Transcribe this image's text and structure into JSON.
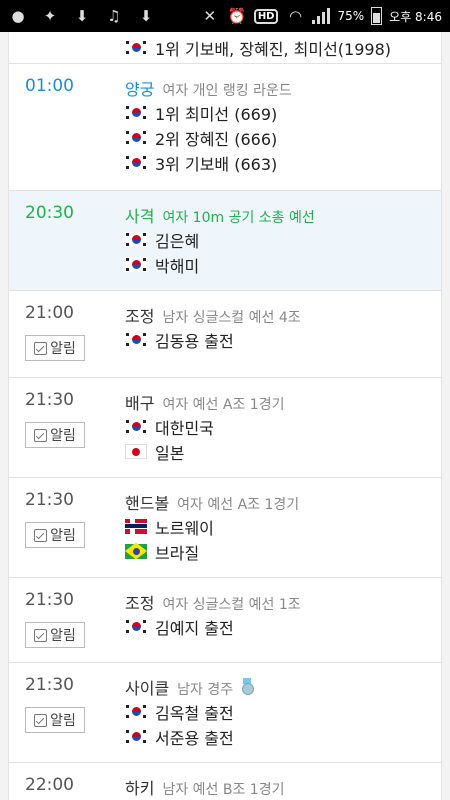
{
  "status_bar": {
    "battery": "75%",
    "time": "오후 8:46",
    "hd": "HD"
  },
  "top_row": {
    "text": "1위 기보배, 장혜진, 최미선(1998)"
  },
  "events": [
    {
      "time": "01:00",
      "sport": "양궁",
      "desc": "여자 개인 랭킹 라운드",
      "lines": [
        "1위 최미선 (669)",
        "2위 장혜진 (666)",
        "3위 기보배 (663)"
      ]
    },
    {
      "time": "20:30",
      "sport": "사격",
      "desc": "여자 10m 공기 소총 예선",
      "lines": [
        "김은혜",
        "박해미"
      ]
    },
    {
      "time": "21:00",
      "alarm": "알림",
      "sport": "조정",
      "desc": "남자 싱글스컬 예선 4조",
      "lines": [
        "김동용 출전"
      ]
    },
    {
      "time": "21:30",
      "alarm": "알림",
      "sport": "배구",
      "desc": "여자 예선 A조 1경기",
      "lines": [
        "대한민국",
        "일본"
      ]
    },
    {
      "time": "21:30",
      "alarm": "알림",
      "sport": "핸드볼",
      "desc": "여자 예선 A조 1경기",
      "lines": [
        "노르웨이",
        "브라질"
      ]
    },
    {
      "time": "21:30",
      "alarm": "알림",
      "sport": "조정",
      "desc": "여자 싱글스컬 예선 1조",
      "lines": [
        "김예지 출전"
      ]
    },
    {
      "time": "21:30",
      "alarm": "알림",
      "sport": "사이클",
      "desc": "남자 경주",
      "lines": [
        "김옥철 출전",
        "서준용 출전"
      ]
    },
    {
      "time": "22:00",
      "sport": "하키",
      "desc": "남자 예선 B조 1경기",
      "lines": []
    }
  ],
  "icons": {
    "flag_korea": "kr",
    "flag_japan": "jp",
    "flag_norway": "no",
    "flag_brazil": "br"
  },
  "colors": {
    "highlight_blue": "#1a8fd8",
    "live_green": "#22b14c",
    "live_bg": "#eef6fb"
  }
}
